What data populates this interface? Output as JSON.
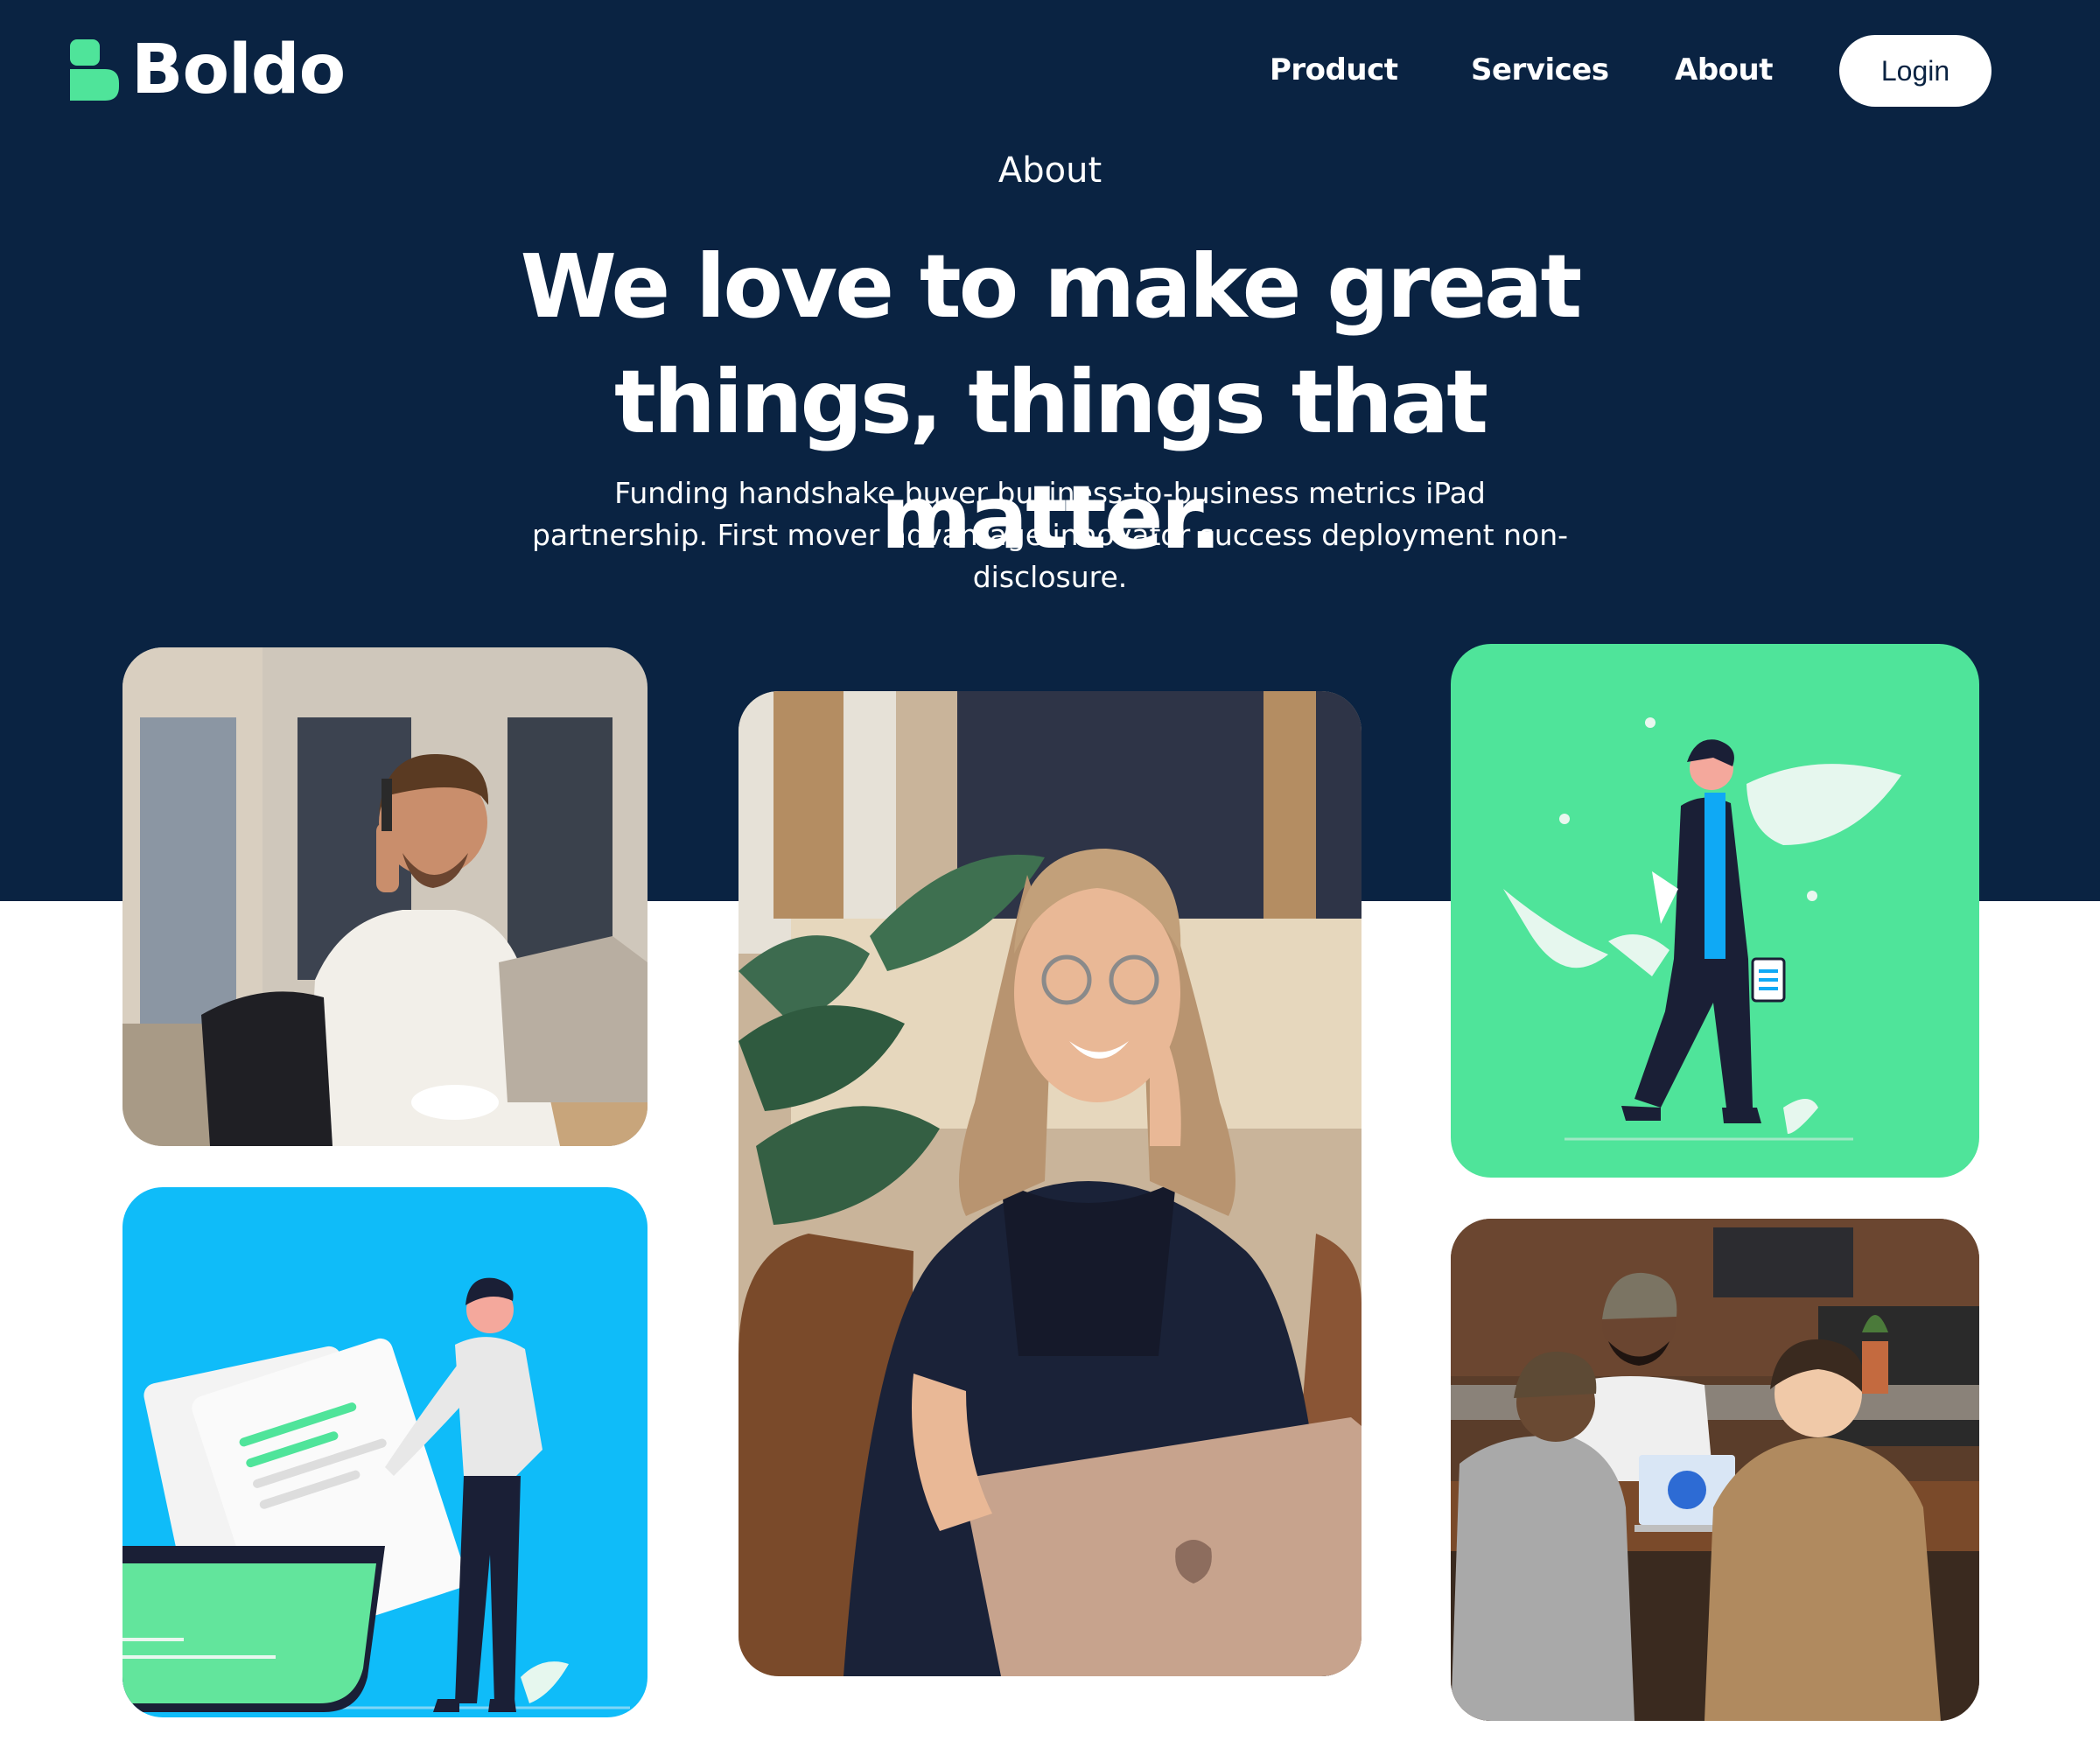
{
  "brand": {
    "name": "Boldo",
    "logo_icon": "boldo-b-icon",
    "accent_color": "#4fe49a",
    "navy_color": "#0a2342"
  },
  "nav": {
    "items": [
      "Product",
      "Services",
      "About"
    ],
    "login_label": "Login"
  },
  "hero": {
    "eyebrow": "About",
    "headline": "We love to make great things, things that matter.",
    "subtext": "Funding handshake buyer business-to-business metrics iPad partnership. First mover advantage innovator success deployment non-disclosure."
  },
  "gallery": [
    {
      "type": "photo",
      "subject": "man-on-phone-at-laptop"
    },
    {
      "type": "photo",
      "subject": "woman-on-phone-with-laptop"
    },
    {
      "type": "illustration",
      "subject": "person-walking-with-tablet",
      "background": "#4fe49a"
    },
    {
      "type": "illustration",
      "subject": "person-with-document-folder",
      "background": "#0fbcf9"
    },
    {
      "type": "photo",
      "subject": "team-meeting-at-table"
    }
  ]
}
